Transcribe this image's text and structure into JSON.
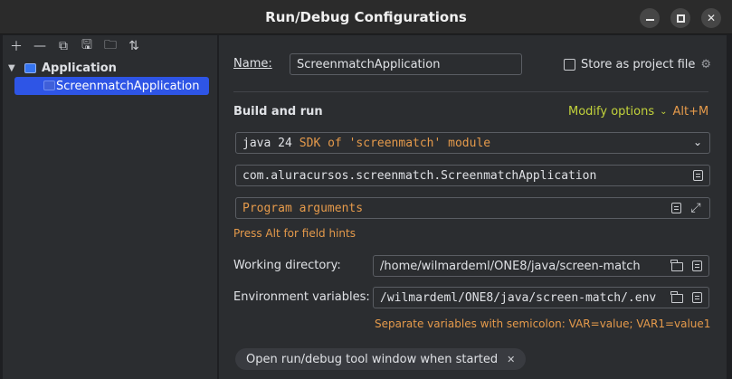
{
  "window": {
    "title": "Run/Debug Configurations"
  },
  "tree": {
    "parent": {
      "label": "Application"
    },
    "child": {
      "label": "ScreenmatchApplication"
    }
  },
  "form": {
    "name_label": "Name:",
    "name_value": "ScreenmatchApplication",
    "store_label": "Store as project file",
    "build_run_label": "Build and run",
    "modify_options": "Modify options",
    "modify_shortcut": "Alt+M",
    "sdk_text": "java 24",
    "sdk_module": "SDK of 'screenmatch' module",
    "main_class": "com.aluracursos.screenmatch.ScreenmatchApplication",
    "program_args_placeholder": "Program arguments",
    "field_hints": "Press Alt for field hints",
    "working_dir_label": "Working directory:",
    "working_dir_value": "/home/wilmardeml/ONE8/java/screen-match",
    "env_label": "Environment variables:",
    "env_value": "/wilmardeml/ONE8/java/screen-match/.env",
    "env_hint": "Separate variables with semicolon: VAR=value; VAR1=value1",
    "chip_label": "Open run/debug tool window when started"
  },
  "colors": {
    "accent": "#2e55e6",
    "hint": "#e59a4b",
    "modify": "#c3d33b"
  }
}
